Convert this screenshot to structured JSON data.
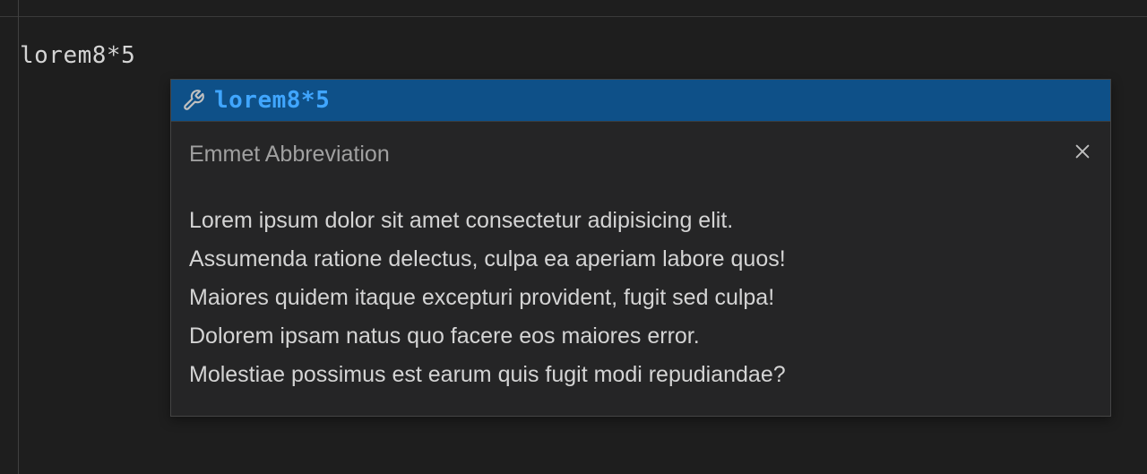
{
  "editor": {
    "typed_text": "lorem8*5"
  },
  "suggestion": {
    "label": "lorem8*5",
    "details_title": "Emmet Abbreviation",
    "preview_lines": [
      "Lorem ipsum dolor sit amet consectetur adipisicing elit.",
      "Assumenda ratione delectus, culpa ea aperiam labore quos!",
      "Maiores quidem itaque excepturi provident, fugit sed culpa!",
      "Dolorem ipsam natus quo facere eos maiores error.",
      "Molestiae possimus est earum quis fugit modi repudiandae?"
    ]
  }
}
